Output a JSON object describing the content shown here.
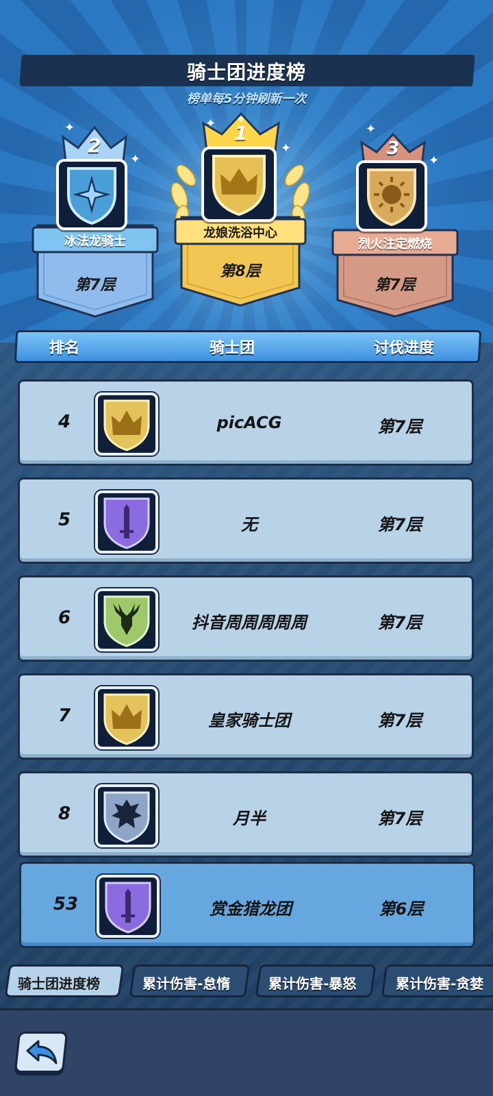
{
  "header": {
    "title": "骑士团进度榜",
    "subtitle": "榜单每5分钟刷新一次"
  },
  "podium": [
    {
      "rank": "2",
      "name": "冰法龙骑士",
      "floor": "第7层",
      "emblem": "compass-star-icon",
      "color": "#8fc0ee"
    },
    {
      "rank": "1",
      "name": "龙娘洗浴中心",
      "floor": "第8层",
      "emblem": "crown-shield-icon",
      "color": "#f5cf59"
    },
    {
      "rank": "3",
      "name": "烈火注定燃烧",
      "floor": "第7层",
      "emblem": "sun-shield-icon",
      "color": "#d9a08a"
    }
  ],
  "columns": {
    "rank": "排名",
    "guild": "骑士团",
    "progress": "讨伐进度"
  },
  "rows": [
    {
      "rank": "4",
      "name": "picACG",
      "progress": "第7层",
      "emblem": "gold-crown-shield-icon"
    },
    {
      "rank": "5",
      "name": "无",
      "progress": "第7层",
      "emblem": "purple-sword-shield-icon"
    },
    {
      "rank": "6",
      "name": "抖音周周周周周",
      "progress": "第7层",
      "emblem": "green-stag-shield-icon"
    },
    {
      "rank": "7",
      "name": "皇家骑士团",
      "progress": "第7层",
      "emblem": "gold-crown-shield-icon"
    },
    {
      "rank": "8",
      "name": "月半",
      "progress": "第7层",
      "emblem": "silver-dragon-shield-icon"
    }
  ],
  "my_guild": {
    "rank": "53",
    "name": "赏金猎龙团",
    "progress": "第6层",
    "emblem": "purple-sword-shield-icon"
  },
  "tabs": [
    {
      "label": "骑士团进度榜",
      "active": true
    },
    {
      "label": "累计伤害-怠惰",
      "active": false
    },
    {
      "label": "累计伤害-暴怒",
      "active": false
    },
    {
      "label": "累计伤害-贪婪",
      "active": false
    }
  ],
  "colors": {
    "gold": "#f5cf59",
    "silver": "#8fc0ee",
    "bronze": "#d9a08a",
    "row": "#b8d3e8",
    "my_row": "#67a7df"
  }
}
